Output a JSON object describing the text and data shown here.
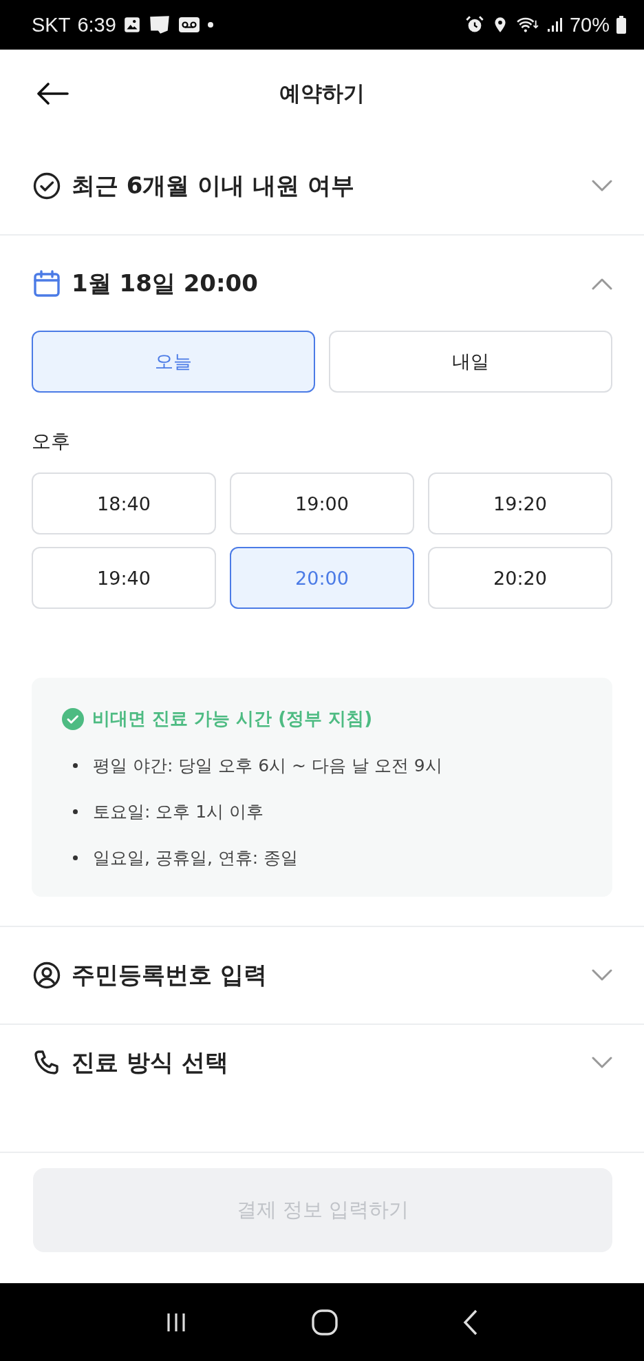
{
  "status_bar": {
    "carrier": "SKT",
    "time": "6:39",
    "battery": "70%"
  },
  "header": {
    "title": "예약하기"
  },
  "sections": [
    {
      "kind": "visit",
      "title": "최근 6개월 이내 내원 여부",
      "expanded": false
    },
    {
      "kind": "datetime",
      "title": "1월 18일 20:00",
      "expanded": true,
      "days": [
        {
          "label": "오늘",
          "selected": true
        },
        {
          "label": "내일",
          "selected": false
        }
      ],
      "period_label": "오후",
      "times": [
        {
          "label": "18:40",
          "selected": false
        },
        {
          "label": "19:00",
          "selected": false
        },
        {
          "label": "19:20",
          "selected": false
        },
        {
          "label": "19:40",
          "selected": false
        },
        {
          "label": "20:00",
          "selected": true
        },
        {
          "label": "20:20",
          "selected": false
        }
      ],
      "notice": {
        "title": "비대면 진료 가능 시간 (정부 지침)",
        "items": [
          "평일 야간: 당일 오후 6시 ~ 다음 날 오전 9시",
          "토요일: 오후 1시 이후",
          "일요일, 공휴일, 연휴: 종일"
        ]
      }
    },
    {
      "kind": "id",
      "title": "주민등록번호 입력",
      "expanded": false
    },
    {
      "kind": "method",
      "title": "진료 방식 선택",
      "expanded": false
    }
  ],
  "footer_button": {
    "label": "결제 정보 입력하기",
    "disabled": true
  }
}
